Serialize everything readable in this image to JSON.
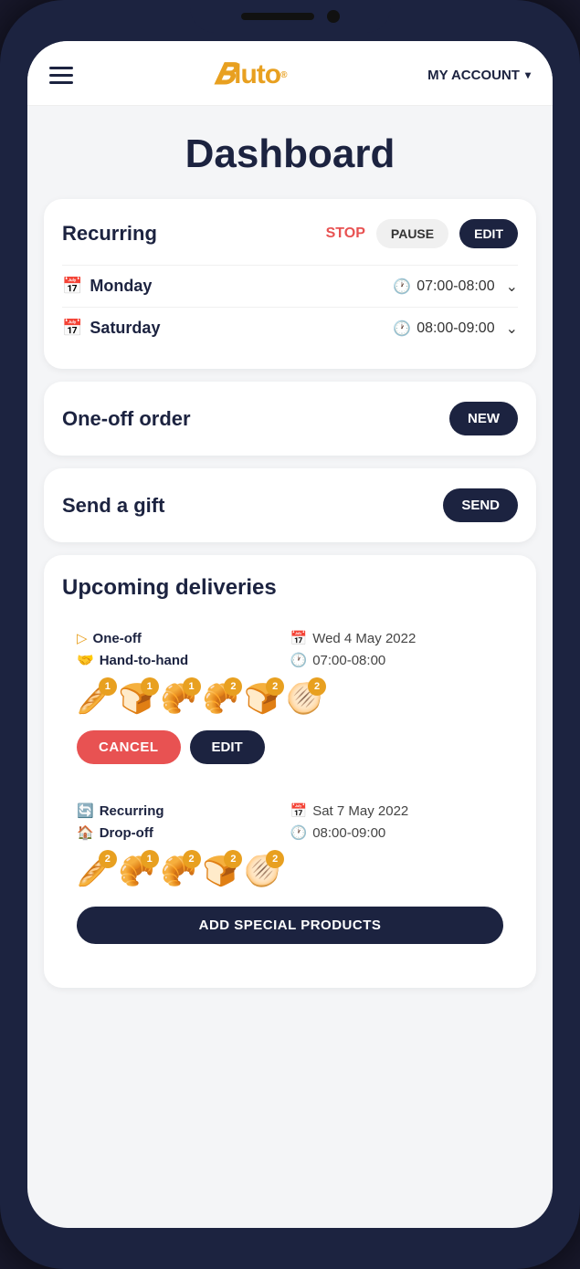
{
  "app": {
    "title": "Dashboard"
  },
  "header": {
    "logo": "Bluto",
    "account_label": "MY ACCOUNT"
  },
  "recurring": {
    "title": "Recurring",
    "stop_label": "STOP",
    "pause_label": "PAUSE",
    "edit_label": "EDIT",
    "schedules": [
      {
        "day": "Monday",
        "time": "07:00-08:00"
      },
      {
        "day": "Saturday",
        "time": "08:00-09:00"
      }
    ]
  },
  "one_off": {
    "title": "One-off order",
    "new_label": "NEW"
  },
  "send_gift": {
    "title": "Send a gift",
    "send_label": "SEND"
  },
  "upcoming": {
    "title": "Upcoming deliveries",
    "deliveries": [
      {
        "type": "One-off",
        "type_icon": "play",
        "delivery_method": "Hand-to-hand",
        "delivery_icon": "hand",
        "date": "Wed 4 May 2022",
        "time": "07:00-08:00",
        "items": [
          {
            "emoji": "🥖",
            "count": 1
          },
          {
            "emoji": "🍞",
            "count": 1
          },
          {
            "emoji": "🥐",
            "count": 1
          },
          {
            "emoji": "🥐",
            "count": 2
          },
          {
            "emoji": "🍞",
            "count": 2
          },
          {
            "emoji": "🫓",
            "count": 2
          }
        ],
        "cancel_label": "CANCEL",
        "edit_label": "EDIT"
      },
      {
        "type": "Recurring",
        "type_icon": "refresh",
        "delivery_method": "Drop-off",
        "delivery_icon": "house",
        "date": "Sat 7 May 2022",
        "time": "08:00-09:00",
        "items": [
          {
            "emoji": "🥖",
            "count": 2
          },
          {
            "emoji": "🥐",
            "count": 1
          },
          {
            "emoji": "🥐",
            "count": 2
          },
          {
            "emoji": "🍞",
            "count": 2
          },
          {
            "emoji": "🫓",
            "count": 2
          }
        ],
        "add_special_label": "ADD SPECIAL PRODUCTS"
      }
    ]
  }
}
